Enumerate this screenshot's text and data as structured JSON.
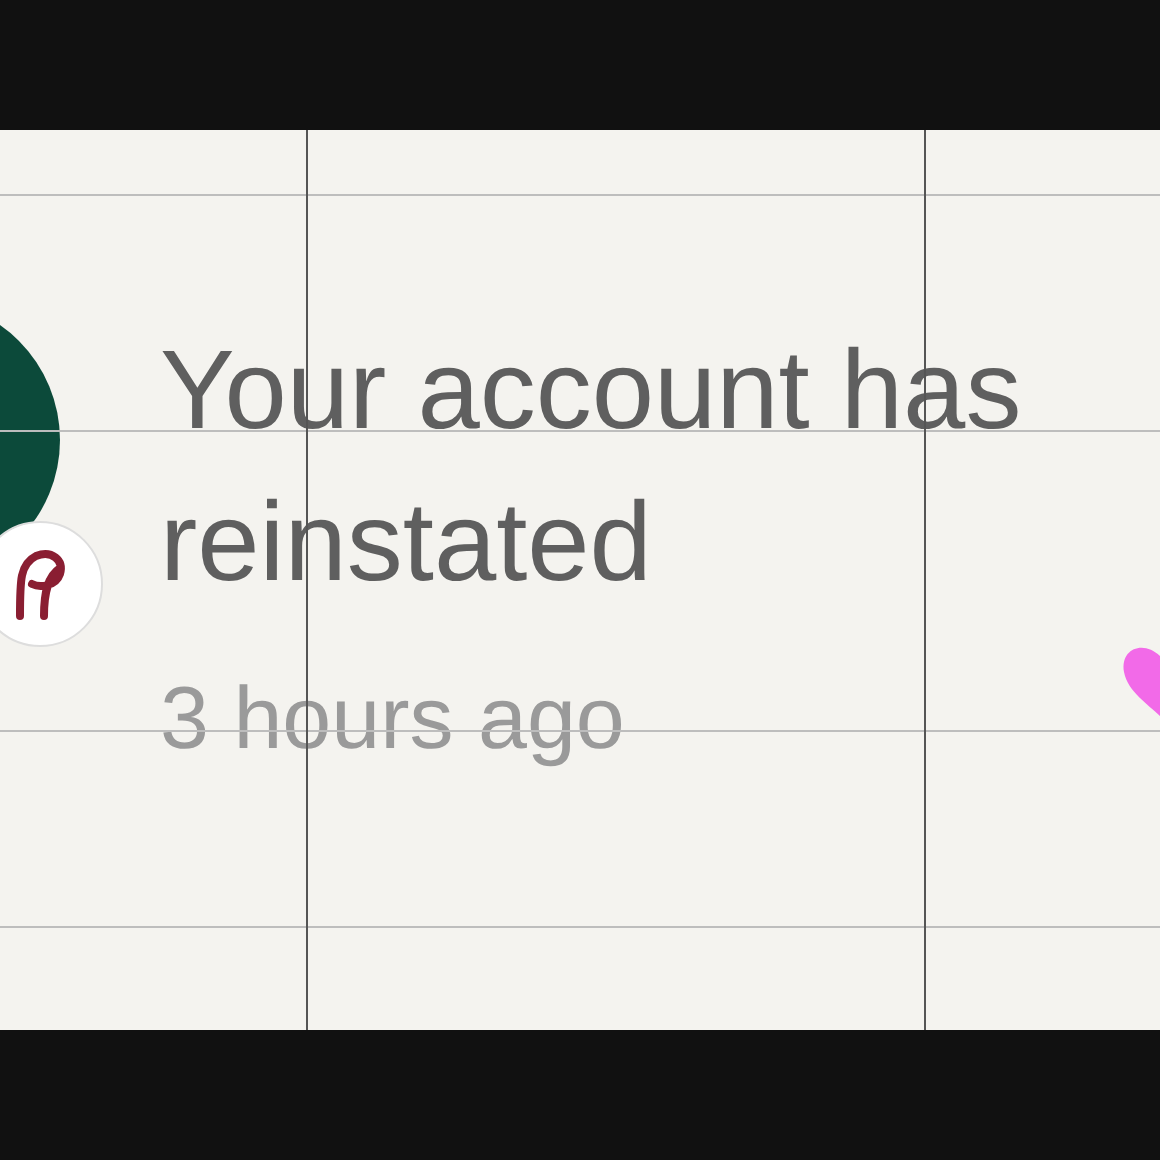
{
  "notification": {
    "message_lines": [
      "Your account has",
      "reinstated"
    ],
    "time": "3 hours ago"
  }
}
